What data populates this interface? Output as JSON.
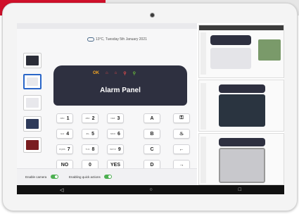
{
  "weather": {
    "text": "13°C, Tuesday 5th January 2021",
    "icon": "cloud-icon"
  },
  "panel": {
    "title": "Alarm Panel",
    "leds": [
      {
        "label": "OK",
        "color": "#f5a623"
      },
      {
        "label": "⌂",
        "color": "#e94b4b"
      },
      {
        "label": "⌂",
        "color": "#e94b4b"
      },
      {
        "label": "⚲",
        "color": "#e94b4b"
      },
      {
        "label": "⚲",
        "color": "#6abf3a"
      }
    ]
  },
  "keys": [
    {
      "label": "1",
      "sub": "ABC"
    },
    {
      "label": "2",
      "sub": "ABC"
    },
    {
      "label": "3",
      "sub": "DEF"
    },
    {
      "label": "A",
      "sub": ""
    },
    {
      "label": "⚿",
      "sub": ""
    },
    {
      "label": "4",
      "sub": "GHI"
    },
    {
      "label": "5",
      "sub": "JKL"
    },
    {
      "label": "6",
      "sub": "MNO"
    },
    {
      "label": "B",
      "sub": ""
    },
    {
      "label": "♨",
      "sub": ""
    },
    {
      "label": "7",
      "sub": "PQRS"
    },
    {
      "label": "8",
      "sub": "TUV"
    },
    {
      "label": "9",
      "sub": "WXYZ"
    },
    {
      "label": "C",
      "sub": ""
    },
    {
      "label": "←",
      "sub": ""
    },
    {
      "label": "NO",
      "sub": ""
    },
    {
      "label": "0",
      "sub": ""
    },
    {
      "label": "YES",
      "sub": ""
    },
    {
      "label": "D",
      "sub": ""
    },
    {
      "label": "→",
      "sub": ""
    }
  ],
  "toggles": {
    "camera": {
      "label": "Enable camera",
      "on": true
    },
    "quick": {
      "label": "Enabling quick actions",
      "on": true
    }
  },
  "nav": {
    "back": "◁",
    "home": "○",
    "recent": "□"
  }
}
